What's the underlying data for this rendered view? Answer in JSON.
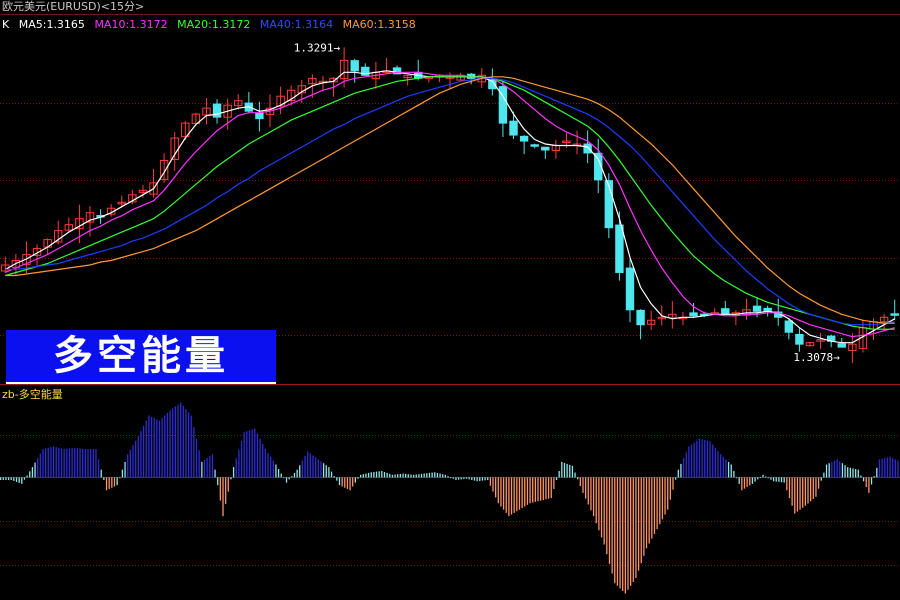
{
  "window_title": "欧元美元(EURUSD)<15分>",
  "colors": {
    "background": "#000000",
    "bull": "#ff3b3b",
    "bear": "#4fe6ee",
    "ma5": "#ffffff",
    "ma10": "#ff33ff",
    "ma20": "#33ff33",
    "ma40": "#1c3cff",
    "ma60": "#ff9933",
    "energy_pos": "#2c2cd8",
    "energy_pos_light": "#8ee8ee",
    "energy_neg": "#ff9466",
    "grid": "#7a1414",
    "banner_bg": "#0a10f0"
  },
  "legend": {
    "k_label": "K",
    "ma5": "MA5:1.3165",
    "ma10": "MA10:1.3172",
    "ma20": "MA20:1.3172",
    "ma40": "MA40:1.3164",
    "ma60": "MA60:1.3158"
  },
  "banner_text": "多空能量",
  "indicator_title": "zb-多空能量",
  "chart_data": [
    {
      "type": "candlestick",
      "title": "欧元美元(EURUSD)<15分>",
      "annotations": [
        {
          "label": "1.3291",
          "arrow": "→",
          "marks": "high"
        },
        {
          "label": "1.3078",
          "arrow": "→",
          "marks": "low"
        }
      ],
      "ylim": [
        1.3068,
        1.3301
      ],
      "closes": [
        1.3145,
        1.3148,
        1.3152,
        1.3156,
        1.3162,
        1.3168,
        1.3172,
        1.3176,
        1.318,
        1.3178,
        1.3183,
        1.3187,
        1.3192,
        1.3195,
        1.32,
        1.3215,
        1.323,
        1.324,
        1.3246,
        1.325,
        1.3244,
        1.3252,
        1.3255,
        1.3248,
        1.3243,
        1.325,
        1.3258,
        1.3262,
        1.3265,
        1.327,
        1.3268,
        1.327,
        1.3282,
        1.3275,
        1.3272,
        1.3274,
        1.3275,
        1.3273,
        1.3272,
        1.327,
        1.3271,
        1.3272,
        1.3271,
        1.3272,
        1.327,
        1.3272,
        1.3263,
        1.324,
        1.3232,
        1.3228,
        1.3225,
        1.3222,
        1.3225,
        1.3228,
        1.3226,
        1.322,
        1.3202,
        1.317,
        1.314,
        1.3115,
        1.3105,
        1.3108,
        1.311,
        1.3112,
        1.311,
        1.3111,
        1.3112,
        1.3113,
        1.3112,
        1.3113,
        1.3115,
        1.3114,
        1.3114,
        1.311,
        1.31,
        1.3092,
        1.3093,
        1.3095,
        1.3094,
        1.309,
        1.3092,
        1.3103,
        1.3107,
        1.311,
        1.3112
      ],
      "series": [
        {
          "name": "MA5",
          "values": [
            1.3142,
            1.3146,
            1.3149,
            1.3153,
            1.3157,
            1.3162,
            1.3167,
            1.3171,
            1.3175,
            1.3177,
            1.318,
            1.3184,
            1.3188,
            1.3192,
            1.3196,
            1.3207,
            1.3219,
            1.323,
            1.3239,
            1.3245,
            1.3246,
            1.3248,
            1.325,
            1.3251,
            1.3248,
            1.3249,
            1.3252,
            1.3256,
            1.3261,
            1.3265,
            1.3267,
            1.3268,
            1.3274,
            1.3274,
            1.3273,
            1.3274,
            1.3275,
            1.3274,
            1.3273,
            1.3272,
            1.3271,
            1.3271,
            1.3271,
            1.3271,
            1.3271,
            1.3271,
            1.3268,
            1.3258,
            1.3246,
            1.3236,
            1.3229,
            1.3226,
            1.3225,
            1.3225,
            1.3225,
            1.3224,
            1.3216,
            1.3198,
            1.3176,
            1.315,
            1.313,
            1.3119,
            1.3111,
            1.3109,
            1.311,
            1.311,
            1.3111,
            1.3112,
            1.3112,
            1.3112,
            1.3113,
            1.3113,
            1.3114,
            1.3113,
            1.3109,
            1.3103,
            1.3098,
            1.3096,
            1.3094,
            1.3093,
            1.3093,
            1.3097,
            1.3101,
            1.3105,
            1.3109
          ]
        },
        {
          "name": "MA10",
          "values": [
            1.314,
            1.3143,
            1.3146,
            1.3149,
            1.3152,
            1.3156,
            1.316,
            1.3164,
            1.3168,
            1.3171,
            1.3175,
            1.3178,
            1.3182,
            1.3185,
            1.3188,
            1.3195,
            1.3204,
            1.3213,
            1.3221,
            1.3228,
            1.3235,
            1.324,
            1.3245,
            1.3247,
            1.3247,
            1.3248,
            1.325,
            1.3253,
            1.3256,
            1.3259,
            1.3262,
            1.3264,
            1.3268,
            1.327,
            1.3271,
            1.3272,
            1.3273,
            1.3274,
            1.3274,
            1.3274,
            1.3273,
            1.3272,
            1.3272,
            1.3272,
            1.3271,
            1.3271,
            1.327,
            1.3266,
            1.3261,
            1.3255,
            1.3249,
            1.3243,
            1.3238,
            1.3234,
            1.3231,
            1.3228,
            1.3222,
            1.3212,
            1.3199,
            1.3183,
            1.3168,
            1.3155,
            1.3143,
            1.3133,
            1.3124,
            1.3117,
            1.3113,
            1.3112,
            1.3111,
            1.3111,
            1.3112,
            1.3112,
            1.3113,
            1.3113,
            1.3111,
            1.3108,
            1.3105,
            1.3103,
            1.3101,
            1.3099,
            1.3097,
            1.3098,
            1.3099,
            1.3101,
            1.3103
          ]
        },
        {
          "name": "MA20",
          "values": [
            1.3138,
            1.314,
            1.3142,
            1.3144,
            1.3146,
            1.3149,
            1.3152,
            1.3155,
            1.3158,
            1.3161,
            1.3164,
            1.3167,
            1.317,
            1.3173,
            1.3176,
            1.3181,
            1.3187,
            1.3193,
            1.3199,
            1.3205,
            1.3211,
            1.3216,
            1.3221,
            1.3226,
            1.323,
            1.3234,
            1.3238,
            1.3242,
            1.3245,
            1.3248,
            1.3251,
            1.3254,
            1.3257,
            1.326,
            1.3262,
            1.3264,
            1.3266,
            1.3268,
            1.3269,
            1.327,
            1.3271,
            1.3271,
            1.3271,
            1.3271,
            1.3271,
            1.3271,
            1.327,
            1.3268,
            1.3265,
            1.3262,
            1.3258,
            1.3254,
            1.325,
            1.3246,
            1.3242,
            1.3238,
            1.3232,
            1.3224,
            1.3215,
            1.3205,
            1.3195,
            1.3185,
            1.3176,
            1.3167,
            1.3159,
            1.3151,
            1.3145,
            1.3139,
            1.3134,
            1.313,
            1.3126,
            1.3123,
            1.312,
            1.3118,
            1.3116,
            1.3114,
            1.3112,
            1.311,
            1.3108,
            1.3106,
            1.3104,
            1.3103,
            1.3102,
            1.3102,
            1.3102
          ]
        },
        {
          "name": "MA40",
          "values": [
            1.3142,
            1.3142,
            1.3143,
            1.3144,
            1.3145,
            1.3146,
            1.3148,
            1.315,
            1.3152,
            1.3154,
            1.3156,
            1.3158,
            1.3161,
            1.3163,
            1.3166,
            1.3169,
            1.3173,
            1.3177,
            1.3181,
            1.3185,
            1.319,
            1.3194,
            1.3199,
            1.3203,
            1.3208,
            1.3212,
            1.3216,
            1.322,
            1.3224,
            1.3228,
            1.3232,
            1.3236,
            1.3239,
            1.3243,
            1.3246,
            1.3249,
            1.3252,
            1.3255,
            1.3258,
            1.326,
            1.3262,
            1.3264,
            1.3266,
            1.3268,
            1.3269,
            1.327,
            1.327,
            1.3269,
            1.3267,
            1.3264,
            1.3261,
            1.3258,
            1.3255,
            1.3252,
            1.3249,
            1.3246,
            1.3242,
            1.3237,
            1.3231,
            1.3225,
            1.3218,
            1.321,
            1.3202,
            1.3194,
            1.3186,
            1.3178,
            1.317,
            1.3162,
            1.3155,
            1.3148,
            1.3141,
            1.3135,
            1.3129,
            1.3124,
            1.3119,
            1.3115,
            1.3112,
            1.311,
            1.3108,
            1.3106,
            1.3105,
            1.3105,
            1.3105,
            1.3106,
            1.3107
          ]
        },
        {
          "name": "MA60",
          "values": [
            1.3138,
            1.3138,
            1.3139,
            1.314,
            1.3141,
            1.3142,
            1.3143,
            1.3144,
            1.3145,
            1.3147,
            1.3148,
            1.315,
            1.3152,
            1.3154,
            1.3156,
            1.3159,
            1.3162,
            1.3165,
            1.3168,
            1.3172,
            1.3176,
            1.318,
            1.3184,
            1.3188,
            1.3192,
            1.3196,
            1.32,
            1.3204,
            1.3208,
            1.3212,
            1.3216,
            1.322,
            1.3224,
            1.3228,
            1.3232,
            1.3236,
            1.324,
            1.3244,
            1.3248,
            1.3252,
            1.3256,
            1.326,
            1.3263,
            1.3266,
            1.3268,
            1.327,
            1.3271,
            1.3271,
            1.327,
            1.3268,
            1.3266,
            1.3264,
            1.3262,
            1.326,
            1.3258,
            1.3256,
            1.3253,
            1.3249,
            1.3244,
            1.3238,
            1.3232,
            1.3226,
            1.3219,
            1.3212,
            1.3204,
            1.3196,
            1.3188,
            1.318,
            1.3172,
            1.3164,
            1.3157,
            1.315,
            1.3143,
            1.3137,
            1.3131,
            1.3126,
            1.3122,
            1.3118,
            1.3115,
            1.3112,
            1.311,
            1.3108,
            1.3107,
            1.3106,
            1.3106
          ]
        }
      ]
    },
    {
      "type": "bar",
      "title": "zb-多空能量",
      "ylim": [
        -0.95,
        0.6
      ],
      "values": [
        -0.02,
        -0.05,
        0.08,
        0.22,
        0.24,
        0.22,
        0.23,
        0.22,
        0.22,
        -0.1,
        -0.06,
        0.18,
        0.32,
        0.48,
        0.44,
        0.52,
        0.58,
        0.48,
        0.12,
        0.18,
        -0.3,
        0.08,
        0.35,
        0.38,
        0.22,
        0.1,
        -0.04,
        0.06,
        0.2,
        0.14,
        0.08,
        -0.06,
        -0.1,
        0.02,
        0.04,
        0.05,
        0.02,
        0.03,
        0.02,
        0.03,
        0.04,
        0.02,
        -0.02,
        -0.01,
        -0.03,
        -0.02,
        -0.2,
        -0.3,
        -0.25,
        -0.2,
        -0.18,
        -0.16,
        0.12,
        0.09,
        -0.12,
        -0.3,
        -0.52,
        -0.82,
        -0.9,
        -0.78,
        -0.55,
        -0.4,
        -0.25,
        0.06,
        0.24,
        0.3,
        0.28,
        0.18,
        0.1,
        -0.1,
        -0.05,
        0.02,
        -0.03,
        -0.04,
        -0.28,
        -0.22,
        -0.15,
        0.1,
        0.14,
        0.08,
        0.06,
        -0.12,
        0.14,
        0.16,
        0.12
      ]
    }
  ]
}
